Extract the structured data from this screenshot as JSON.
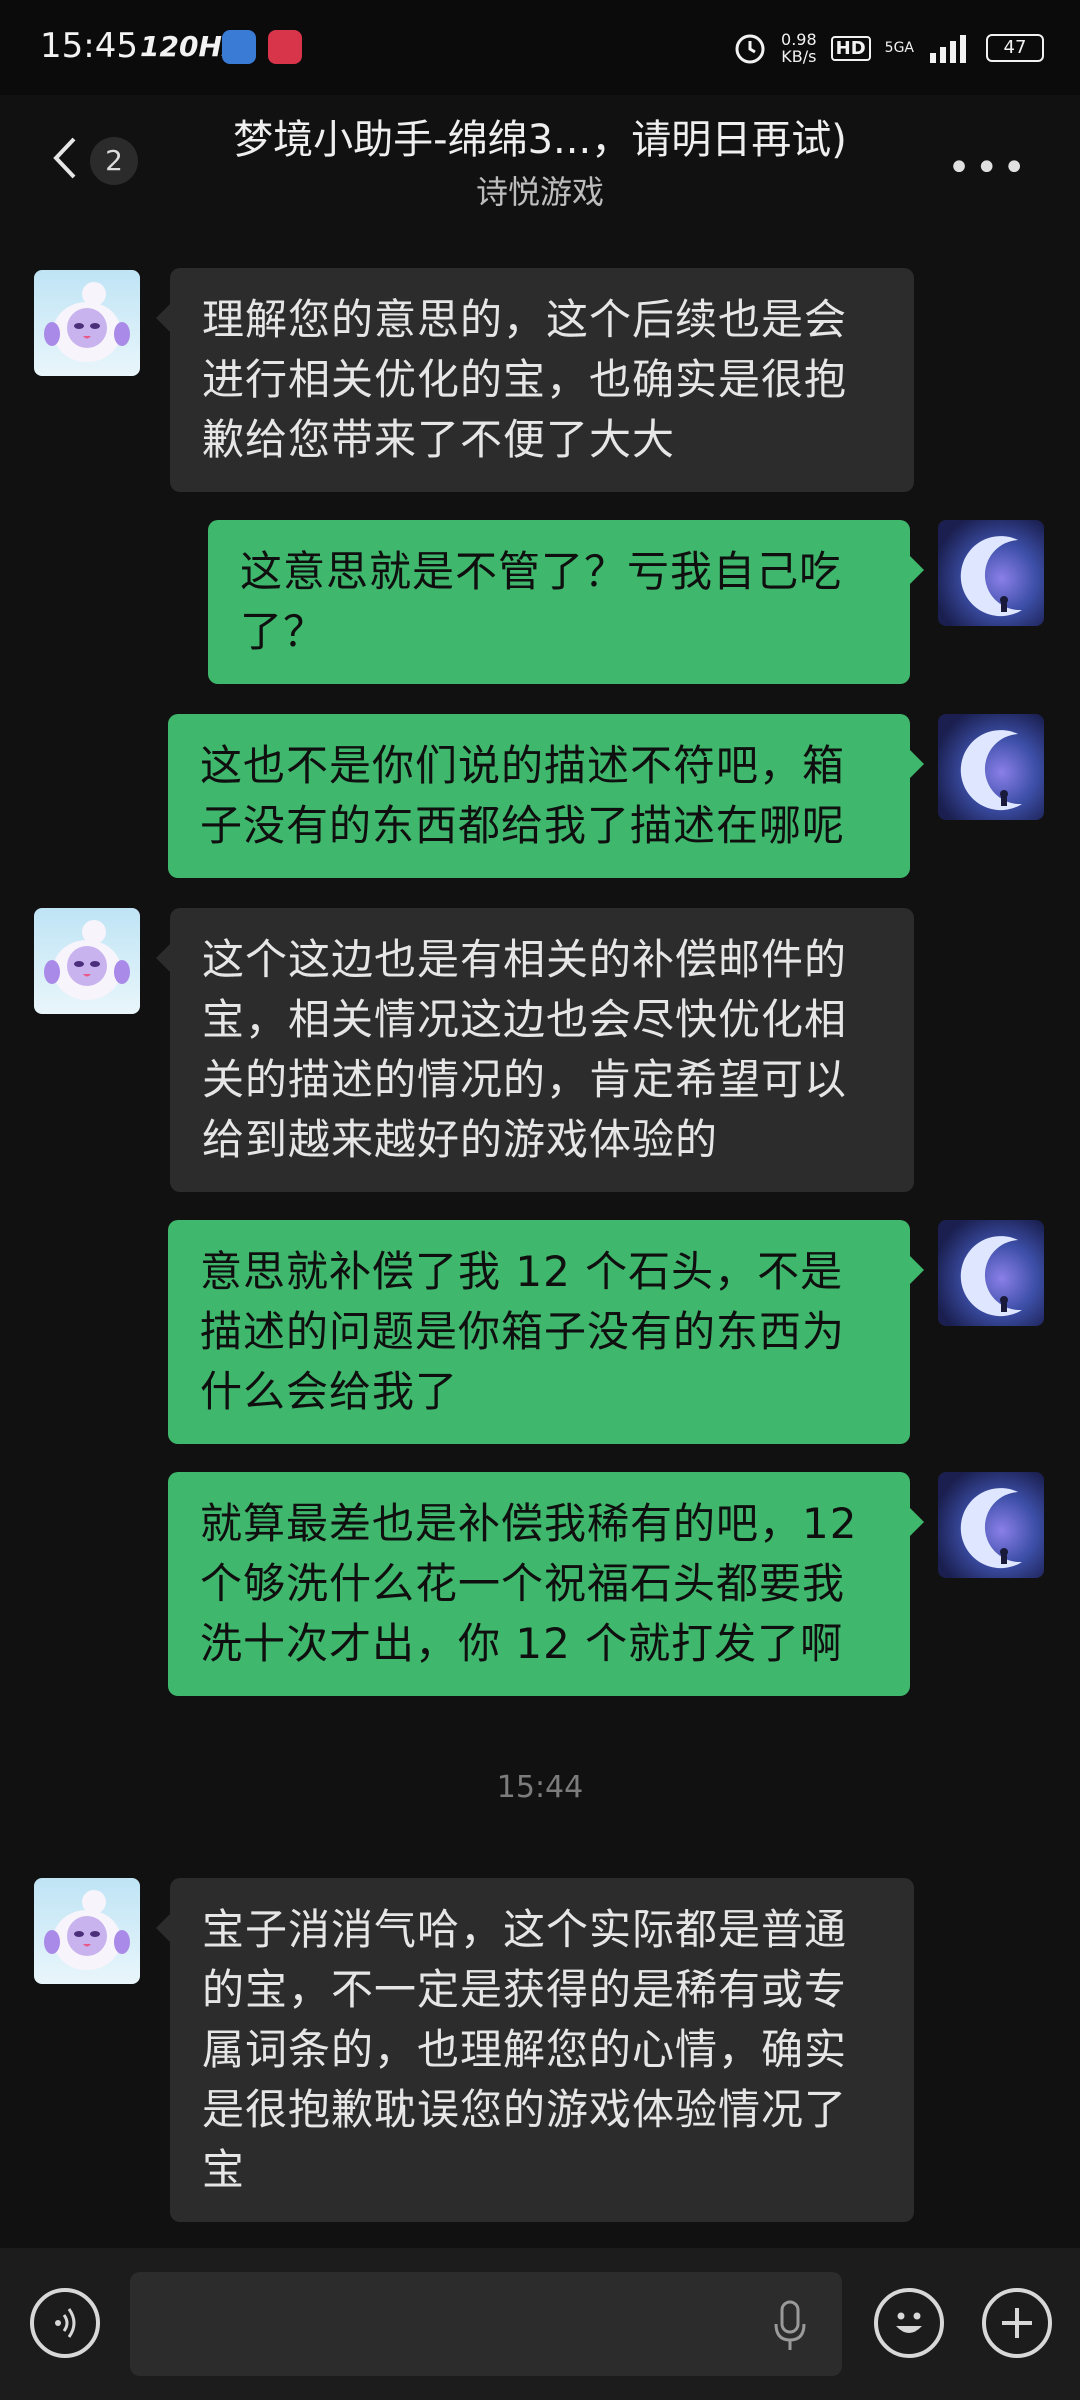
{
  "status_bar": {
    "time": "15:45",
    "refresh_rate": "120Hz",
    "net_speed_value": "0.98",
    "net_speed_unit": "KB/s",
    "hd": "HD",
    "network": "5GA",
    "battery": "47"
  },
  "header": {
    "unread_count": "2",
    "title": "梦境小助手-绵绵3...，请明日再试)",
    "subtitle": "诗悦游戏"
  },
  "messages": [
    {
      "sender": "bot",
      "text": "理解您的意思的，这个后续也是会进行相关优化的宝，也确实是很抱歉给您带来了不便了大大"
    },
    {
      "sender": "me",
      "text": "这意思就是不管了？亏我自己吃了？"
    },
    {
      "sender": "me",
      "text": "这也不是你们说的描述不符吧，箱子没有的东西都给我了描述在哪呢"
    },
    {
      "sender": "bot",
      "text": "这个这边也是有相关的补偿邮件的宝，相关情况这边也会尽快优化相关的描述的情况的，肯定希望可以给到越来越好的游戏体验的"
    },
    {
      "sender": "me",
      "text": "意思就补偿了我 12 个石头，不是描述的问题是你箱子没有的东西为什么会给我了"
    },
    {
      "sender": "me",
      "text": "就算最差也是补偿我稀有的吧，12 个够洗什么花一个祝福石头都要我洗十次才出，你 12 个就打发了啊"
    },
    {
      "sender": "bot",
      "text": "宝子消消气哈，这个实际都是普通的宝，不一定是获得的是稀有或专属词条的，也理解您的心情，确实是很抱歉耽误您的游戏体验情况了宝"
    }
  ],
  "time_separator": "15:44",
  "input": {
    "value": ""
  },
  "icons": {
    "back": "chevron-left-icon",
    "more": "more-dots-icon",
    "voice": "voice-icon",
    "mic": "microphone-icon",
    "emoji": "emoji-icon",
    "add": "plus-icon"
  }
}
